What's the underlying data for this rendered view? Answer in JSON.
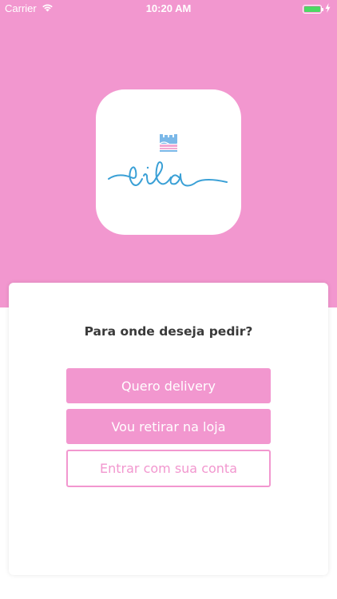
{
  "status_bar": {
    "carrier": "Carrier",
    "time": "10:20 AM",
    "wifi_icon": "wifi-icon",
    "battery_icon": "battery-icon",
    "charging_icon": "bolt-icon"
  },
  "logo": {
    "text": "lila",
    "colors": {
      "script": "#3aa0d6",
      "castle_blue": "#7bb8e8",
      "castle_pink": "#f2a9d3"
    }
  },
  "main": {
    "question": "Para onde deseja pedir?",
    "buttons": {
      "delivery": "Quero delivery",
      "pickup": "Vou retirar na loja",
      "login": "Entrar com sua conta"
    }
  },
  "colors": {
    "brand_pink": "#f297cf",
    "text_dark": "#3a3a3a",
    "background": "#ffffff"
  }
}
